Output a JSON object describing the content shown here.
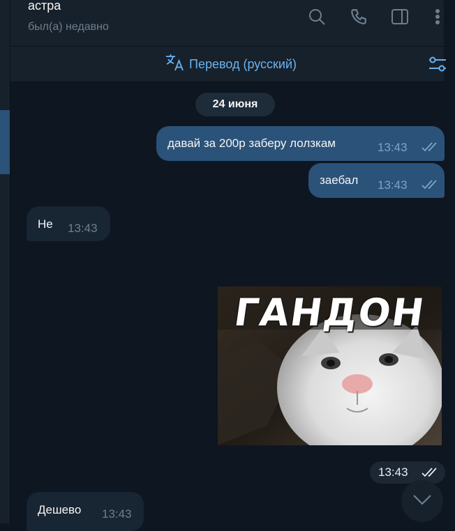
{
  "chat": {
    "name": "астра",
    "status": "был(а) недавно"
  },
  "header_icons": [
    "search-icon",
    "phone-icon",
    "sidebar-toggle-icon",
    "more-vertical-icon"
  ],
  "translate_bar": {
    "label": "Перевод (русский)",
    "icon": "translate-icon",
    "settings_icon": "settings-sliders-icon"
  },
  "date_separator": "24 июня",
  "messages": [
    {
      "direction": "out",
      "text": "давай за 200р заберу лолзкам",
      "time": "13:43",
      "read": true
    },
    {
      "direction": "out",
      "text": "заебал",
      "time": "13:43",
      "read": true
    },
    {
      "direction": "in",
      "text": "Не",
      "time": "13:43"
    },
    {
      "direction": "out",
      "type": "sticker",
      "sticker_text": "ГАНДОН",
      "time": "13:43",
      "read": true
    },
    {
      "direction": "in",
      "text": "Дешево",
      "time": "13:43"
    }
  ],
  "colors": {
    "background": "#0e1621",
    "panel": "#17212b",
    "outgoing_bubble": "#2b5278",
    "incoming_bubble": "#182533",
    "accent": "#6ab2f2",
    "muted": "#6d7f8f"
  }
}
